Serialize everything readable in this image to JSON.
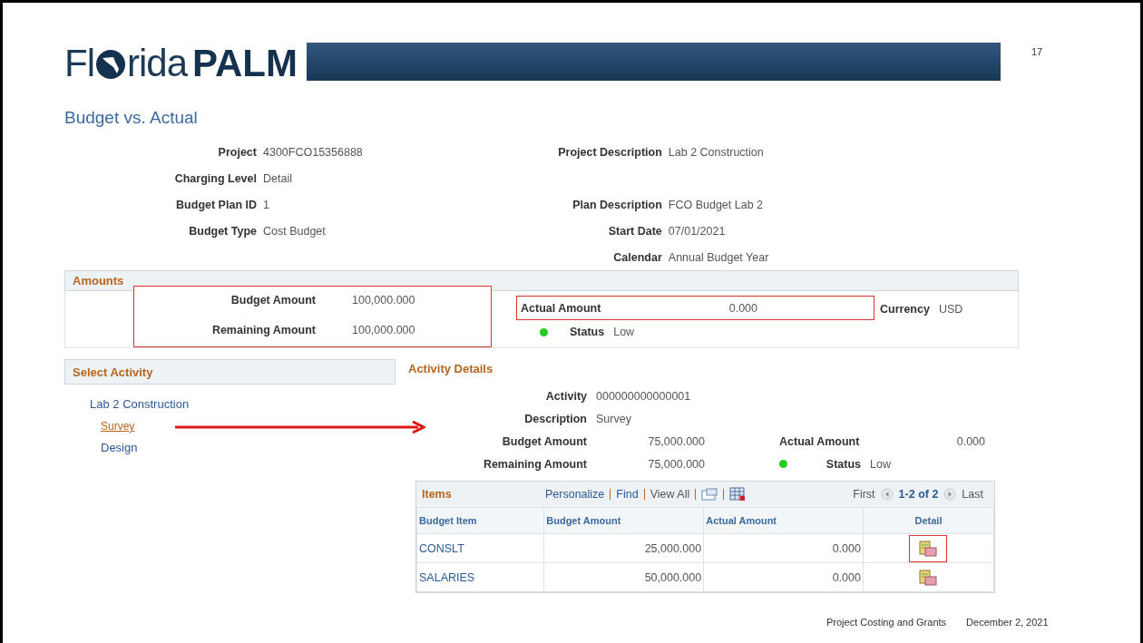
{
  "header": {
    "logo_prefix": "Fl",
    "logo_suffix": "rida",
    "logo_bold": "PALM",
    "page_number": "17"
  },
  "title": "Budget vs. Actual",
  "project_fields_left": [
    {
      "label": "Project",
      "value": "4300FCO15356888"
    },
    {
      "label": "Charging Level",
      "value": "Detail"
    },
    {
      "label": "Budget Plan ID",
      "value": "1"
    },
    {
      "label": "Budget Type",
      "value": "Cost Budget"
    }
  ],
  "project_fields_right": [
    {
      "label": "Project Description",
      "value": "Lab 2 Construction"
    },
    {
      "label": "Plan Description",
      "value": "FCO Budget Lab 2"
    },
    {
      "label": "Start Date",
      "value": "07/01/2021"
    },
    {
      "label": "Calendar",
      "value": "Annual Budget Year"
    }
  ],
  "amounts": {
    "title": "Amounts",
    "budget_amount": {
      "label": "Budget Amount",
      "value": "100,000.000"
    },
    "remaining_amount": {
      "label": "Remaining Amount",
      "value": "100,000.000"
    },
    "actual_amount": {
      "label": "Actual Amount",
      "value": "0.000"
    },
    "currency": {
      "label": "Currency",
      "value": "USD"
    },
    "status": {
      "label": "Status",
      "value": "Low",
      "color": "#22cc22"
    }
  },
  "select_activity": {
    "title": "Select Activity",
    "items": [
      {
        "label": "Lab 2 Construction",
        "selected": false,
        "children": [
          {
            "label": "Survey",
            "selected": true
          },
          {
            "label": "Design",
            "selected": false
          }
        ]
      }
    ]
  },
  "activity_details": {
    "title": "Activity Details",
    "activity": {
      "label": "Activity",
      "value": "000000000000001"
    },
    "description": {
      "label": "Description",
      "value": "Survey"
    },
    "budget_amount": {
      "label": "Budget Amount",
      "value": "75,000.000"
    },
    "remaining_amount": {
      "label": "Remaining Amount",
      "value": "75,000.000"
    },
    "actual_amount": {
      "label": "Actual Amount",
      "value": "0.000"
    },
    "status": {
      "label": "Status",
      "value": "Low",
      "color": "#22cc22"
    }
  },
  "items": {
    "title": "Items",
    "links": [
      "Personalize",
      "Find"
    ],
    "view_all": "View All",
    "first": "First",
    "range": "1-2 of 2",
    "last": "Last",
    "columns": [
      "Budget Item",
      "Budget Amount",
      "Actual Amount",
      "Detail"
    ],
    "rows": [
      {
        "budget_item": "CONSLT",
        "budget_amount": "25,000.000",
        "actual_amount": "0.000",
        "highlighted": true
      },
      {
        "budget_item": "SALARIES",
        "budget_amount": "50,000.000",
        "actual_amount": "0.000",
        "highlighted": false
      }
    ]
  },
  "footer": {
    "section": "Project Costing and Grants",
    "date": "December 2, 2021"
  }
}
